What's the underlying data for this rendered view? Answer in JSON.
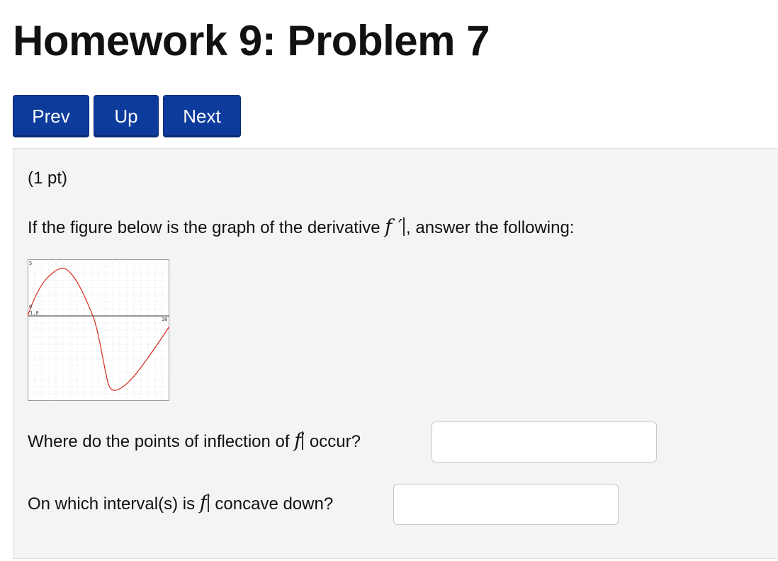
{
  "page": {
    "title": "Homework 9: Problem 7"
  },
  "nav": {
    "prev_label": "Prev",
    "up_label": "Up",
    "next_label": "Next",
    "button_color": "#0d3b9c"
  },
  "problem": {
    "points": "(1 pt)",
    "prompt_before": "If the figure below is the graph of the derivative ",
    "prompt_math": "f ′",
    "prompt_after": ", answer the following:",
    "questions": [
      {
        "before": "Where do the points of inflection of ",
        "math": "f",
        "after": " occur?",
        "value": ""
      },
      {
        "before": "On which interval(s) is ",
        "math": "f",
        "after": " concave down?",
        "value": ""
      }
    ]
  },
  "graph": {
    "label_top": "5",
    "label_origin": "0",
    "label_xmin": "1.0",
    "label_xmax": "30",
    "curve_color": "#d42a1e"
  }
}
